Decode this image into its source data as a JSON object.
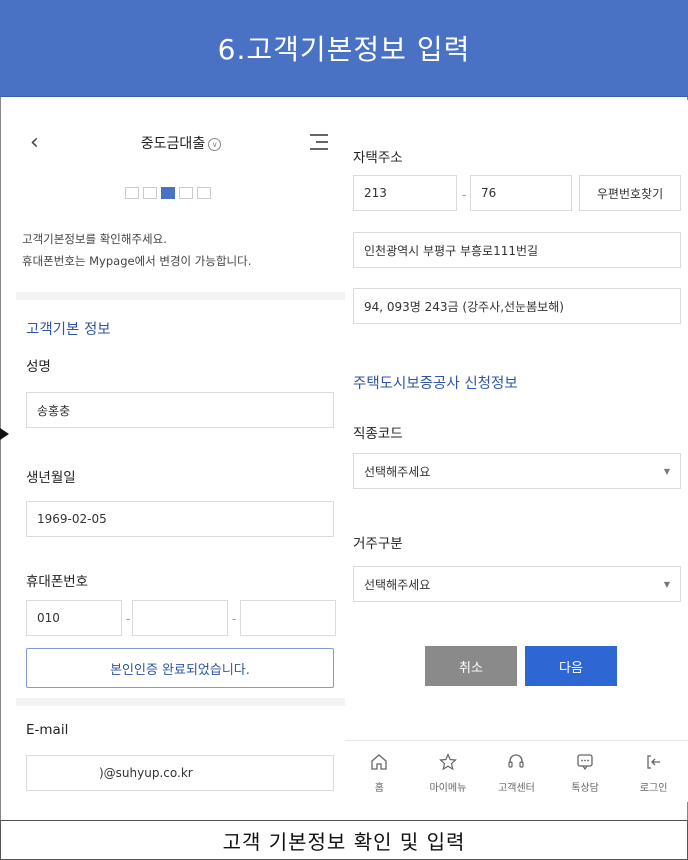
{
  "banner": {
    "title": "6.고객기본정보 입력"
  },
  "left": {
    "header_title": "중도금대출",
    "notice": [
      "고객기본정보를 확인해주세요.",
      "휴대폰번호는 Mypage에서 변경이 가능합니다."
    ],
    "section_title": "고객기본 정보",
    "name_label": "성명",
    "name_value": "송홍충",
    "birth_label": "생년월일",
    "birth_value": "1969-02-05",
    "phone_label": "휴대폰번호",
    "phone_first": "010",
    "phone_middle": "",
    "phone_last": "",
    "verify_button": "본인인증 완료되었습니다.",
    "email_label": "E-mail",
    "email_value": ")@suhyup.co.kr"
  },
  "right": {
    "address_label": "자택주소",
    "postal_1": "213",
    "postal_2": "76",
    "postal_search_button": "우편번호찾기",
    "address_line1": "인천광역시 부평구 부흥로111번길",
    "address_line2": "94, 093명 243금 (강주사,선눈봄보해)",
    "section_title": "주택도시보증공사 신청정보",
    "job_label": "직종코드",
    "job_select": "선택해주세요",
    "residence_label": "거주구분",
    "residence_select": "선택해주세요",
    "cancel_button": "취소",
    "next_button": "다음",
    "tabbar": [
      "홈",
      "마이메뉴",
      "고객센터",
      "톡상담",
      "로그인"
    ]
  },
  "caption": "고객 기본정보 확인 및 입력",
  "colors": {
    "banner": "#4a72c4",
    "accent": "#2f55a6",
    "next_button": "#2e66d4",
    "cancel_button": "#8a8a8a"
  }
}
